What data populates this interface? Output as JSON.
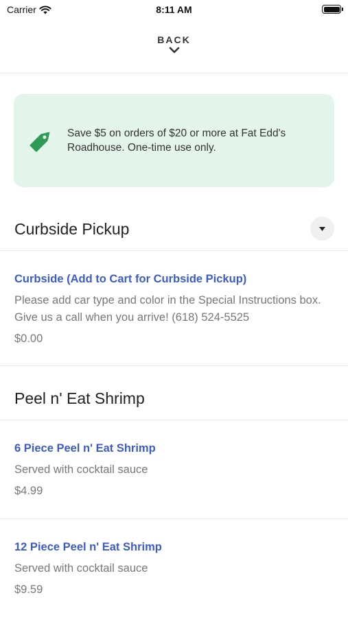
{
  "status_bar": {
    "carrier": "Carrier",
    "time": "8:11 AM"
  },
  "nav": {
    "back_label": "BACK"
  },
  "promo": {
    "text": "Save $5 on orders of $20 or more at Fat Edd's Roadhouse. One-time use only.",
    "accent_color": "#2e9a55",
    "background": "#e3f4ea"
  },
  "sections": [
    {
      "title": "Curbside Pickup",
      "items": [
        {
          "name": "Curbside (Add to Cart for Curbside Pickup)",
          "description": "Please add car type and color in the Special Instructions box. Give us a call when you arrive! (618) 524-5525",
          "price": "$0.00"
        }
      ]
    },
    {
      "title": "Peel n' Eat Shrimp",
      "items": [
        {
          "name": "6 Piece Peel n' Eat Shrimp",
          "description": "Served with cocktail sauce",
          "price": "$4.99"
        },
        {
          "name": "12 Piece Peel n' Eat Shrimp",
          "description": "Served with cocktail sauce",
          "price": "$9.59"
        }
      ]
    }
  ],
  "icons": {
    "promo": "price-tag-icon",
    "dropdown": "caret-down-icon",
    "back": "chevron-down-icon",
    "wifi": "wifi-icon",
    "battery": "battery-icon"
  },
  "colors": {
    "link": "#3b5bcc"
  }
}
